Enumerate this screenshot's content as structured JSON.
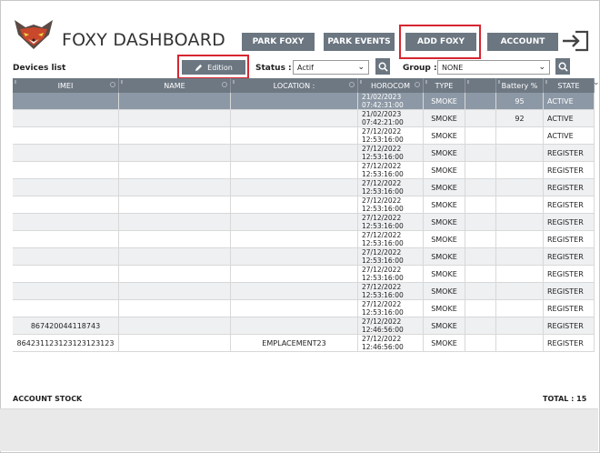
{
  "header": {
    "title": "FOXY DASHBOARD",
    "nav": [
      "PARK FOXY",
      "PARK EVENTS",
      "ADD FOXY",
      "ACCOUNT"
    ],
    "logo_icon": "fox-logo-icon",
    "logout_icon": "logout-icon"
  },
  "filters": {
    "devices_label": "Devices list",
    "edit_label": "Edition",
    "status_label": "Status :",
    "status_value": "Actif",
    "group_label": "Group :",
    "group_value": "NONE"
  },
  "table": {
    "columns": [
      "IMEI",
      "NAME",
      "LOCATION :",
      "HOROCOM",
      "TYPE",
      "",
      "Battery %",
      "STATE"
    ],
    "rows": [
      {
        "imei": "",
        "name": "",
        "location": "",
        "date": "21/02/2023",
        "time": "07:42:31:00",
        "type": "SMOKE",
        "battery": "95",
        "state": "ACTIVE",
        "selected": true
      },
      {
        "imei": "",
        "name": "",
        "location": "",
        "date": "21/02/2023",
        "time": "07:42:21:00",
        "type": "SMOKE",
        "battery": "92",
        "state": "ACTIVE"
      },
      {
        "imei": "",
        "name": "",
        "location": "",
        "date": "27/12/2022",
        "time": "12:53:16:00",
        "type": "SMOKE",
        "battery": "",
        "state": "ACTIVE"
      },
      {
        "imei": "",
        "name": "",
        "location": "",
        "date": "27/12/2022",
        "time": "12:53:16:00",
        "type": "SMOKE",
        "battery": "",
        "state": "REGISTER"
      },
      {
        "imei": "",
        "name": "",
        "location": "",
        "date": "27/12/2022",
        "time": "12:53:16:00",
        "type": "SMOKE",
        "battery": "",
        "state": "REGISTER"
      },
      {
        "imei": "",
        "name": "",
        "location": "",
        "date": "27/12/2022",
        "time": "12:53:16:00",
        "type": "SMOKE",
        "battery": "",
        "state": "REGISTER"
      },
      {
        "imei": "",
        "name": "",
        "location": "",
        "date": "27/12/2022",
        "time": "12:53:16:00",
        "type": "SMOKE",
        "battery": "",
        "state": "REGISTER"
      },
      {
        "imei": "",
        "name": "",
        "location": "",
        "date": "27/12/2022",
        "time": "12:53:16:00",
        "type": "SMOKE",
        "battery": "",
        "state": "REGISTER"
      },
      {
        "imei": "",
        "name": "",
        "location": "",
        "date": "27/12/2022",
        "time": "12:53:16:00",
        "type": "SMOKE",
        "battery": "",
        "state": "REGISTER"
      },
      {
        "imei": "",
        "name": "",
        "location": "",
        "date": "27/12/2022",
        "time": "12:53:16:00",
        "type": "SMOKE",
        "battery": "",
        "state": "REGISTER"
      },
      {
        "imei": "",
        "name": "",
        "location": "",
        "date": "27/12/2022",
        "time": "12:53:16:00",
        "type": "SMOKE",
        "battery": "",
        "state": "REGISTER"
      },
      {
        "imei": "",
        "name": "",
        "location": "",
        "date": "27/12/2022",
        "time": "12:53:16:00",
        "type": "SMOKE",
        "battery": "",
        "state": "REGISTER"
      },
      {
        "imei": "",
        "name": "",
        "location": "",
        "date": "27/12/2022",
        "time": "12:53:16:00",
        "type": "SMOKE",
        "battery": "",
        "state": "REGISTER"
      },
      {
        "imei": "867420044118743",
        "name": "",
        "location": "",
        "date": "27/12/2022",
        "time": "12:46:56:00",
        "type": "SMOKE",
        "battery": "",
        "state": "REGISTER"
      },
      {
        "imei": "864231123123123123123",
        "name": "",
        "location": "EMPLACEMENT23",
        "date": "27/12/2022",
        "time": "12:46:56:00",
        "type": "SMOKE",
        "battery": "",
        "state": "REGISTER"
      }
    ]
  },
  "footer": {
    "stock_label": "ACCOUNT STOCK",
    "total_label": "TOTAL : 15"
  },
  "colors": {
    "button_bg": "#6b7681",
    "header_bg": "#6e7883",
    "selected_row": "#8c98a5",
    "highlight": "#d62631"
  }
}
